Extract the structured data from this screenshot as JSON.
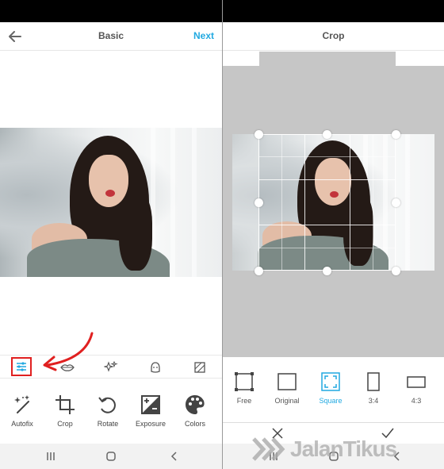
{
  "left_screen": {
    "header": {
      "title": "Basic",
      "next_label": "Next"
    },
    "tools": [
      {
        "label": "Autofix",
        "icon": "magic-wand-icon"
      },
      {
        "label": "Crop",
        "icon": "crop-icon"
      },
      {
        "label": "Rotate",
        "icon": "rotate-icon"
      },
      {
        "label": "Exposure",
        "icon": "exposure-icon"
      },
      {
        "label": "Colors",
        "icon": "palette-icon"
      }
    ],
    "subtabs": [
      "adjust-sliders-icon",
      "lips-icon",
      "sparkle-icon",
      "face-icon",
      "texture-icon"
    ],
    "active_subtab": "adjust-sliders-icon",
    "highlight_color": "#e02020"
  },
  "right_screen": {
    "header": {
      "title": "Crop"
    },
    "ratios": [
      {
        "label": "Free",
        "icon": "crop-free-icon"
      },
      {
        "label": "Original",
        "icon": "crop-original-icon"
      },
      {
        "label": "Square",
        "icon": "crop-square-icon"
      },
      {
        "label": "3:4",
        "icon": "crop-portrait-icon"
      },
      {
        "label": "4:3",
        "icon": "crop-landscape-icon"
      }
    ],
    "selected_ratio": "Square"
  },
  "watermark": "JalanTikus",
  "accent_color": "#21a9e1"
}
